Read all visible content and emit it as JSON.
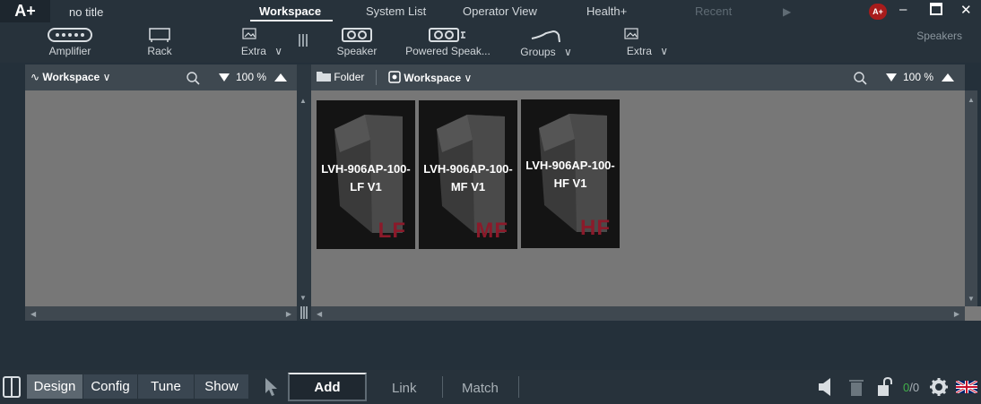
{
  "app": {
    "logo": "A+",
    "title": "no title"
  },
  "tabs": [
    {
      "label": "Workspace",
      "active": true
    },
    {
      "label": "System List"
    },
    {
      "label": "Operator View"
    },
    {
      "label": "Health+"
    },
    {
      "label": "Recent",
      "disabled": true
    }
  ],
  "title_bar": {
    "play": "▶",
    "account_badge": "A+",
    "minimize": "–",
    "maximize": "□",
    "close": "✕"
  },
  "toolbar": {
    "amplifier": "Amplifier",
    "rack": "Rack",
    "extra_left": "Extra",
    "speaker": "Speaker",
    "powered_speaker": "Powered Speak...",
    "groups": "Groups",
    "extra_right": "Extra",
    "right_label": "Speakers",
    "chevron": "∨"
  },
  "left_pane": {
    "workspace_label": "Workspace",
    "zoom": "100 %"
  },
  "right_pane": {
    "folder_label": "Folder",
    "workspace_label": "Workspace",
    "zoom": "100 %"
  },
  "speakers": [
    {
      "name_line1": "LVH-906AP-100-",
      "name_line2": "LF V1",
      "band": "LF"
    },
    {
      "name_line1": "LVH-906AP-100-",
      "name_line2": "MF V1",
      "band": "MF"
    },
    {
      "name_line1": "LVH-906AP-100-",
      "name_line2": "HF V1",
      "band": "HF"
    }
  ],
  "bottom": {
    "modes": [
      "Design",
      "Config",
      "Tune",
      "Show"
    ],
    "active_mode": "Design",
    "add": "Add",
    "link": "Link",
    "match": "Match",
    "counter_value": "0",
    "counter_total": "/0"
  },
  "colors": {
    "accent_red": "#a81c1c",
    "band_red": "#8b1a2a",
    "workspace_gray": "#777777",
    "counter_green": "#41b04a"
  }
}
